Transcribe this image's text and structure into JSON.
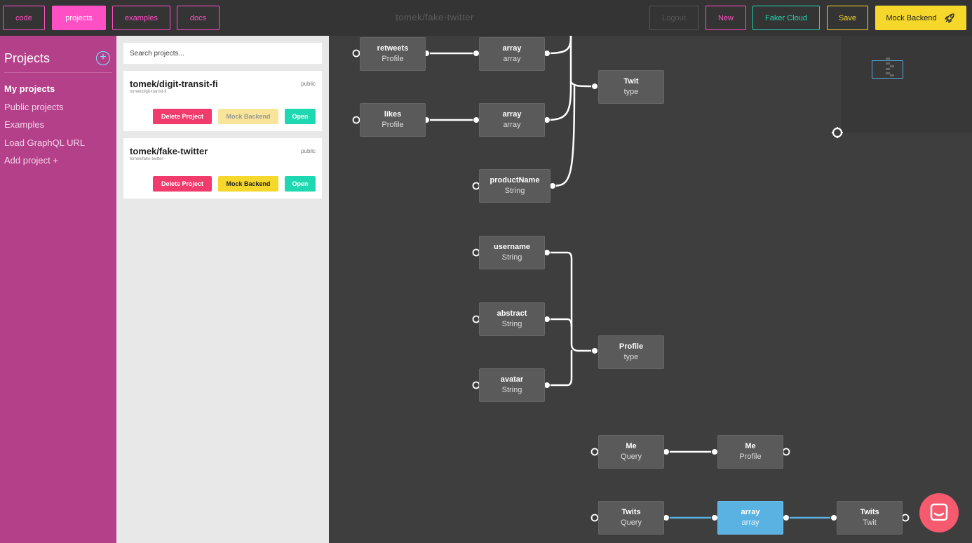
{
  "topbar": {
    "tabs": [
      {
        "label": "code"
      },
      {
        "label": "projects"
      },
      {
        "label": "examples"
      },
      {
        "label": "docs"
      }
    ],
    "title": "tomek/fake-twitter",
    "actions": {
      "logout": "Logout",
      "new": "New",
      "faker_cloud": "Faker Cloud",
      "save": "Save",
      "mock_backend": "Mock Backend"
    }
  },
  "sidebar": {
    "heading": "Projects",
    "add_icon": "plus-circle-icon",
    "items": [
      {
        "label": "My projects"
      },
      {
        "label": "Public projects"
      },
      {
        "label": "Examples"
      },
      {
        "label": "Load GraphQL URL"
      },
      {
        "label": "Add project +"
      }
    ]
  },
  "projects": {
    "search_placeholder": "Search projects...",
    "cards": [
      {
        "name": "tomek/digit-transit-fi",
        "sub": "tomek/digit-transit-fi",
        "visibility": "public",
        "delete": "Delete Project",
        "mock": "Mock Backend",
        "open": "Open"
      },
      {
        "name": "tomek/fake-twitter",
        "sub": "tomek/fake-twitter",
        "visibility": "public",
        "delete": "Delete Project",
        "mock": "Mock Backend",
        "open": "Open"
      }
    ]
  },
  "graph": {
    "nodes": [
      {
        "title": "retweets",
        "sub": "Profile"
      },
      {
        "title": "array",
        "sub": "array"
      },
      {
        "title": "Twit",
        "sub": "type"
      },
      {
        "title": "likes",
        "sub": "Profile"
      },
      {
        "title": "array",
        "sub": "array"
      },
      {
        "title": "productName",
        "sub": "String"
      },
      {
        "title": "username",
        "sub": "String"
      },
      {
        "title": "abstract",
        "sub": "String"
      },
      {
        "title": "Profile",
        "sub": "type"
      },
      {
        "title": "avatar",
        "sub": "String"
      },
      {
        "title": "Me",
        "sub": "Query"
      },
      {
        "title": "Me",
        "sub": "Profile"
      },
      {
        "title": "Twits",
        "sub": "Query"
      },
      {
        "title": "array",
        "sub": "array"
      },
      {
        "title": "Twits",
        "sub": "Twit"
      }
    ]
  },
  "colors": {
    "accent_pink": "#ff4fc4",
    "teal": "#1ed8b1",
    "yellow": "#f5d82b",
    "delete_red": "#f13b6d",
    "selected_node": "#5ab2e2",
    "sidebar": "#b4408a"
  },
  "icons": {
    "rocket": "rocket-icon",
    "chat": "chat-bubble-icon",
    "drag": "drag-handle-icon"
  }
}
